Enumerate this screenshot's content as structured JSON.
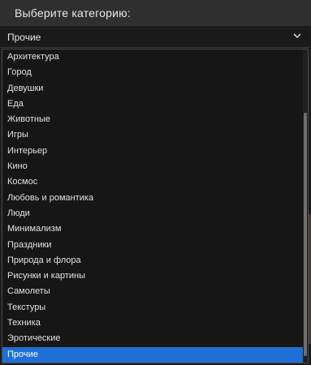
{
  "header": {
    "title": "Выберите категорию:"
  },
  "select": {
    "value": "Прочие",
    "icon": "chevron-down-icon"
  },
  "options": [
    "Архитектура",
    "Город",
    "Девушки",
    "Еда",
    "Животные",
    "Игры",
    "Интерьер",
    "Кино",
    "Космос",
    "Любовь и романтика",
    "Люди",
    "Минимализм",
    "Праздники",
    "Природа и флора",
    "Рисунки и картины",
    "Самолеты",
    "Текстуры",
    "Техника",
    "Эротические",
    "Прочие"
  ],
  "selected_index": 19,
  "colors": {
    "highlight": "#1f6fd6",
    "header_bg": "#2f2f2f",
    "list_bg": "#161616"
  }
}
